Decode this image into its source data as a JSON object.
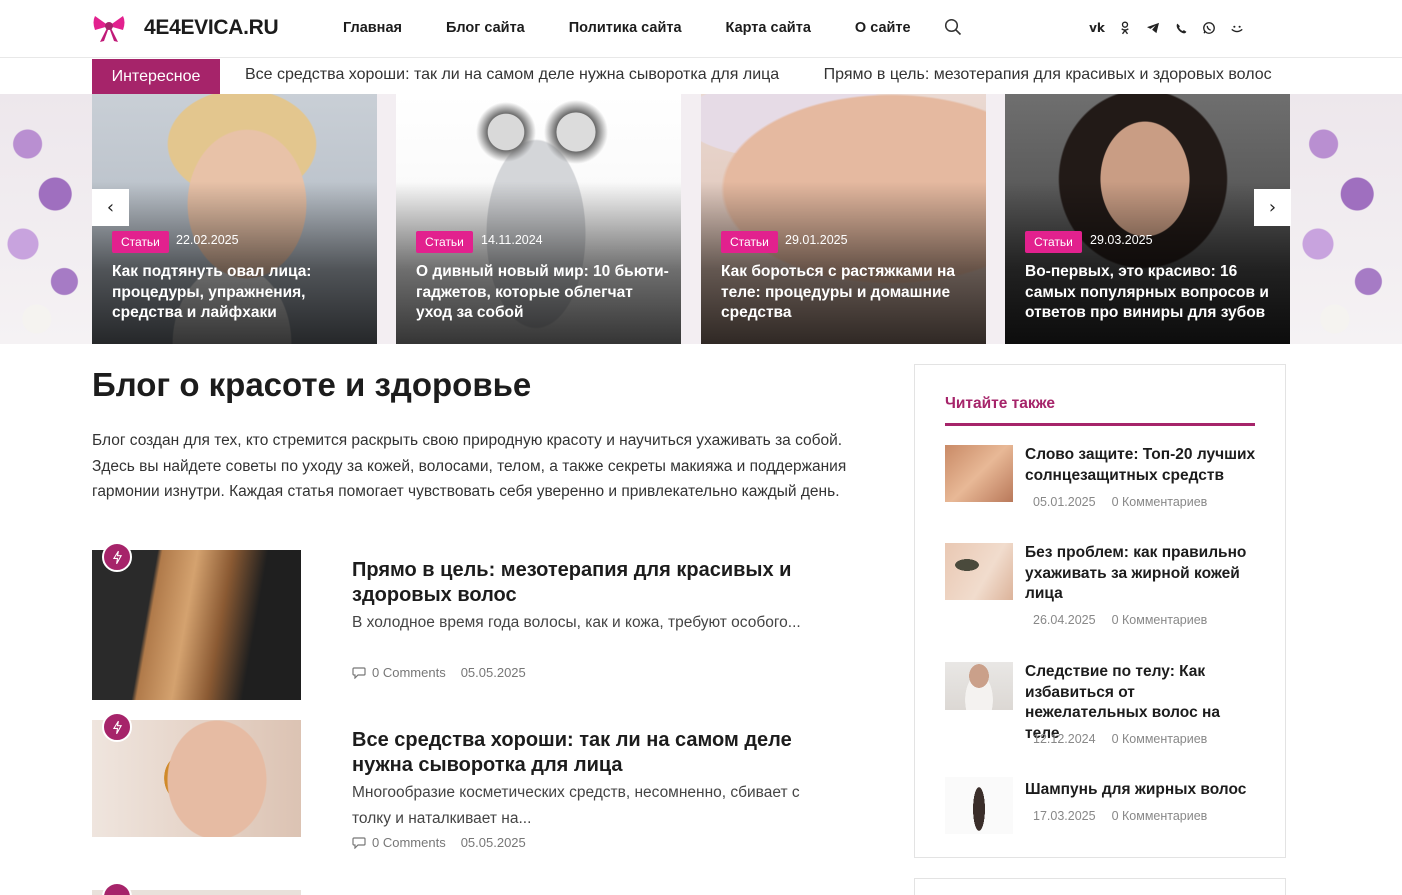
{
  "header": {
    "logo_text": "4E4EVICA.RU",
    "nav": [
      "Главная",
      "Блог сайта",
      "Политика сайта",
      "Карта сайта",
      "О сайте"
    ],
    "social_icons": [
      "vk-icon",
      "odnoklassniki-icon",
      "telegram-icon",
      "viber-icon",
      "whatsapp-icon",
      "smile-icon"
    ]
  },
  "ticker": {
    "label": "Интересное",
    "items": [
      "Все средства хороши: так ли на самом деле нужна сыворотка для лица",
      "Прямо в цель: мезотерапия для красивых и здоровых волос"
    ]
  },
  "slider": {
    "prev": "‹",
    "next": "›",
    "slides": [
      {
        "category": "Статьи",
        "date": "22.02.2025",
        "title": "Как подтянуть овал лица: процедуры, упражнения, средства и лайфхаки"
      },
      {
        "category": "Статьи",
        "date": "14.11.2024",
        "title": "О дивный новый мир: 10 бьюти-гаджетов, которые облегчат уход за собой"
      },
      {
        "category": "Статьи",
        "date": "29.01.2025",
        "title": "Как бороться с растяжками на теле: процедуры и домашние средства"
      },
      {
        "category": "Статьи",
        "date": "29.03.2025",
        "title": "Во-первых, это красиво: 16 самых популярных вопросов и ответов про виниры для зубов"
      }
    ]
  },
  "main": {
    "title": "Блог о красоте и здоровье",
    "intro": "Блог создан для тех, кто стремится раскрыть свою природную красоту и научиться ухаживать за собой. Здесь вы найдете советы по уходу за кожей, волосами, телом, а также секреты макияжа и поддержания гармонии изнутри. Каждая статья помогает чувствовать себя уверенно и привлекательно каждый день.",
    "posts": [
      {
        "title": "Прямо в цель: мезотерапия для красивых и здоровых волос",
        "excerpt": "В холодное время года волосы, как и кожа, требуют особого...",
        "comments": "0 Comments",
        "date": "05.05.2025"
      },
      {
        "title": "Все средства хороши: так ли на самом деле нужна сыворотка для лица",
        "excerpt": "Многообразие косметических средств, несомненно, сбивает с толку и наталкивает на...",
        "comments": "0 Comments",
        "date": "05.05.2025"
      }
    ]
  },
  "sidebar": {
    "heading": "Читайте также",
    "items": [
      {
        "title": "Слово защите: Топ-20 лучших солнцезащитных средств",
        "date": "05.01.2025",
        "comments": "0 Комментариев"
      },
      {
        "title": "Без проблем: как правильно ухаживать за жирной кожей лица",
        "date": "26.04.2025",
        "comments": "0 Комментариев"
      },
      {
        "title": "Следствие по телу: Как избавиться от нежелательных волос на теле",
        "date": "12.12.2024",
        "comments": "0 Комментариев"
      },
      {
        "title": "Шампунь для жирных волос",
        "date": "17.03.2025",
        "comments": "0 Комментариев"
      }
    ]
  },
  "colors": {
    "accent": "#a6246a",
    "badge": "#e2218e"
  }
}
